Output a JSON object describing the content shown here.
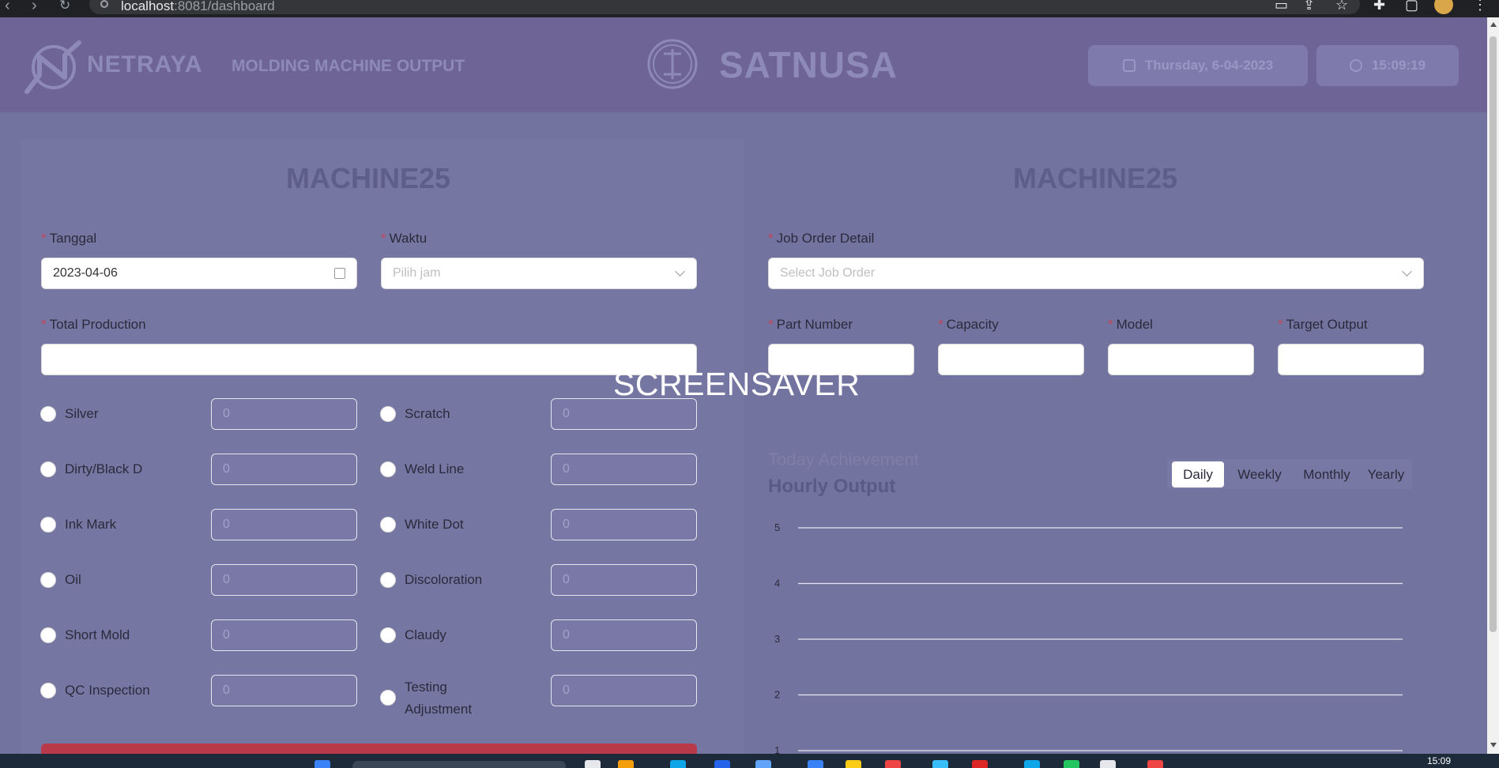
{
  "browser": {
    "url_host": "localhost",
    "url_rest": ":8081/dashboard"
  },
  "header": {
    "logo_text": "NETRAYA",
    "title": "MOLDING MACHINE OUTPUT",
    "brand": "SATNUSA",
    "date": "Thursday, 6-04-2023",
    "time": "15:09:19"
  },
  "left": {
    "machine": "MACHINE25",
    "tanggal_label": "Tanggal",
    "tanggal_value": "2023-04-06",
    "waktu_label": "Waktu",
    "waktu_placeholder": "Pilih jam",
    "total_label": "Total Production",
    "total_value": "",
    "defects": [
      {
        "label": "Silver",
        "value": "0"
      },
      {
        "label": "Scratch",
        "value": "0"
      },
      {
        "label": "Dirty/Black D",
        "value": "0"
      },
      {
        "label": "Weld Line",
        "value": "0"
      },
      {
        "label": "Ink Mark",
        "value": "0"
      },
      {
        "label": "White Dot",
        "value": "0"
      },
      {
        "label": "Oil",
        "value": "0"
      },
      {
        "label": "Discoloration",
        "value": "0"
      },
      {
        "label": "Short Mold",
        "value": "0"
      },
      {
        "label": "Claudy",
        "value": "0"
      },
      {
        "label": "QC Inspection",
        "value": "0"
      },
      {
        "label": "Testing Adjustment",
        "value": "0"
      }
    ]
  },
  "right": {
    "machine": "MACHINE25",
    "job_label": "Job Order Detail",
    "job_placeholder": "Select Job Order",
    "part_label": "Part Number",
    "capacity_label": "Capacity",
    "model_label": "Model",
    "target_label": "Target Output",
    "today_achievement": "Today Achievement",
    "hourly_output": "Hourly Output",
    "periods": [
      "Daily",
      "Weekly",
      "Monthly",
      "Yearly"
    ],
    "active_period": "Daily"
  },
  "overlay": {
    "screensaver": "SCREENSAVER"
  },
  "chart_data": {
    "type": "line",
    "title": "Hourly Output",
    "y_ticks": [
      "5",
      "4",
      "3",
      "2",
      "1"
    ],
    "ylim": [
      1,
      5
    ],
    "grid": true,
    "series": []
  },
  "taskbar": {
    "time": "15:09"
  },
  "colors": {
    "overlay": "#7373a0",
    "accent_red": "#b83a4a",
    "required_star": "#c4465c"
  }
}
